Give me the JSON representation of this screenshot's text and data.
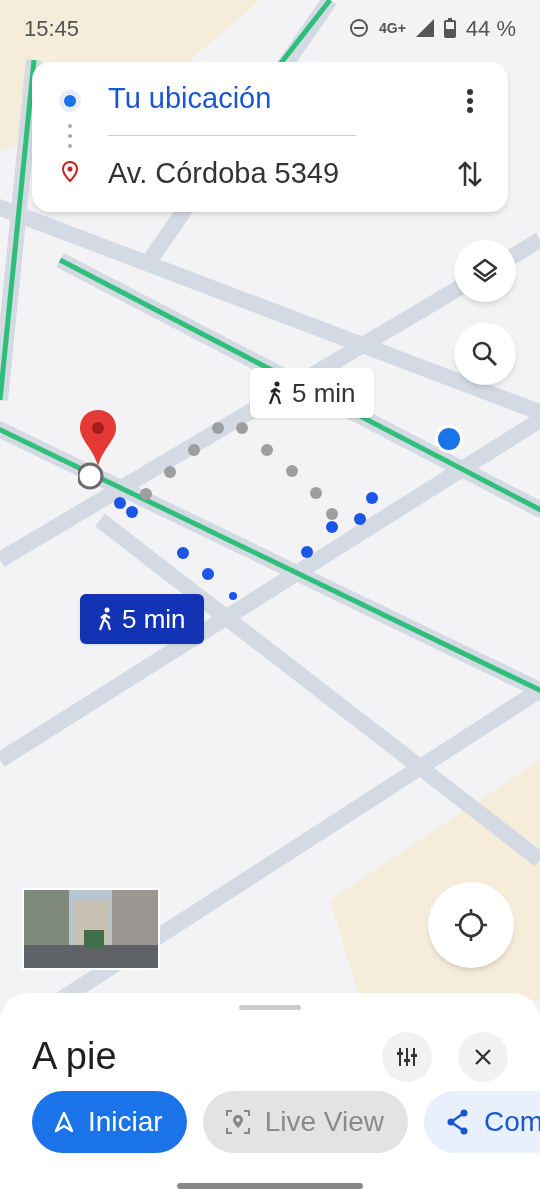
{
  "status_bar": {
    "time": "15:45",
    "network": "4G+",
    "battery": "44 %"
  },
  "directions": {
    "origin": "Tu ubicación",
    "destination": "Av. Córdoba 5349"
  },
  "route_labels": [
    {
      "text": "5 min",
      "selected": false
    },
    {
      "text": "5 min",
      "selected": true
    }
  ],
  "sheet": {
    "title": "A pie",
    "buttons": [
      {
        "kind": "start",
        "label": "Iniciar",
        "disabled": false
      },
      {
        "kind": "live",
        "label": "Live View",
        "disabled": true
      },
      {
        "kind": "share",
        "label": "Com",
        "disabled": false
      }
    ]
  }
}
